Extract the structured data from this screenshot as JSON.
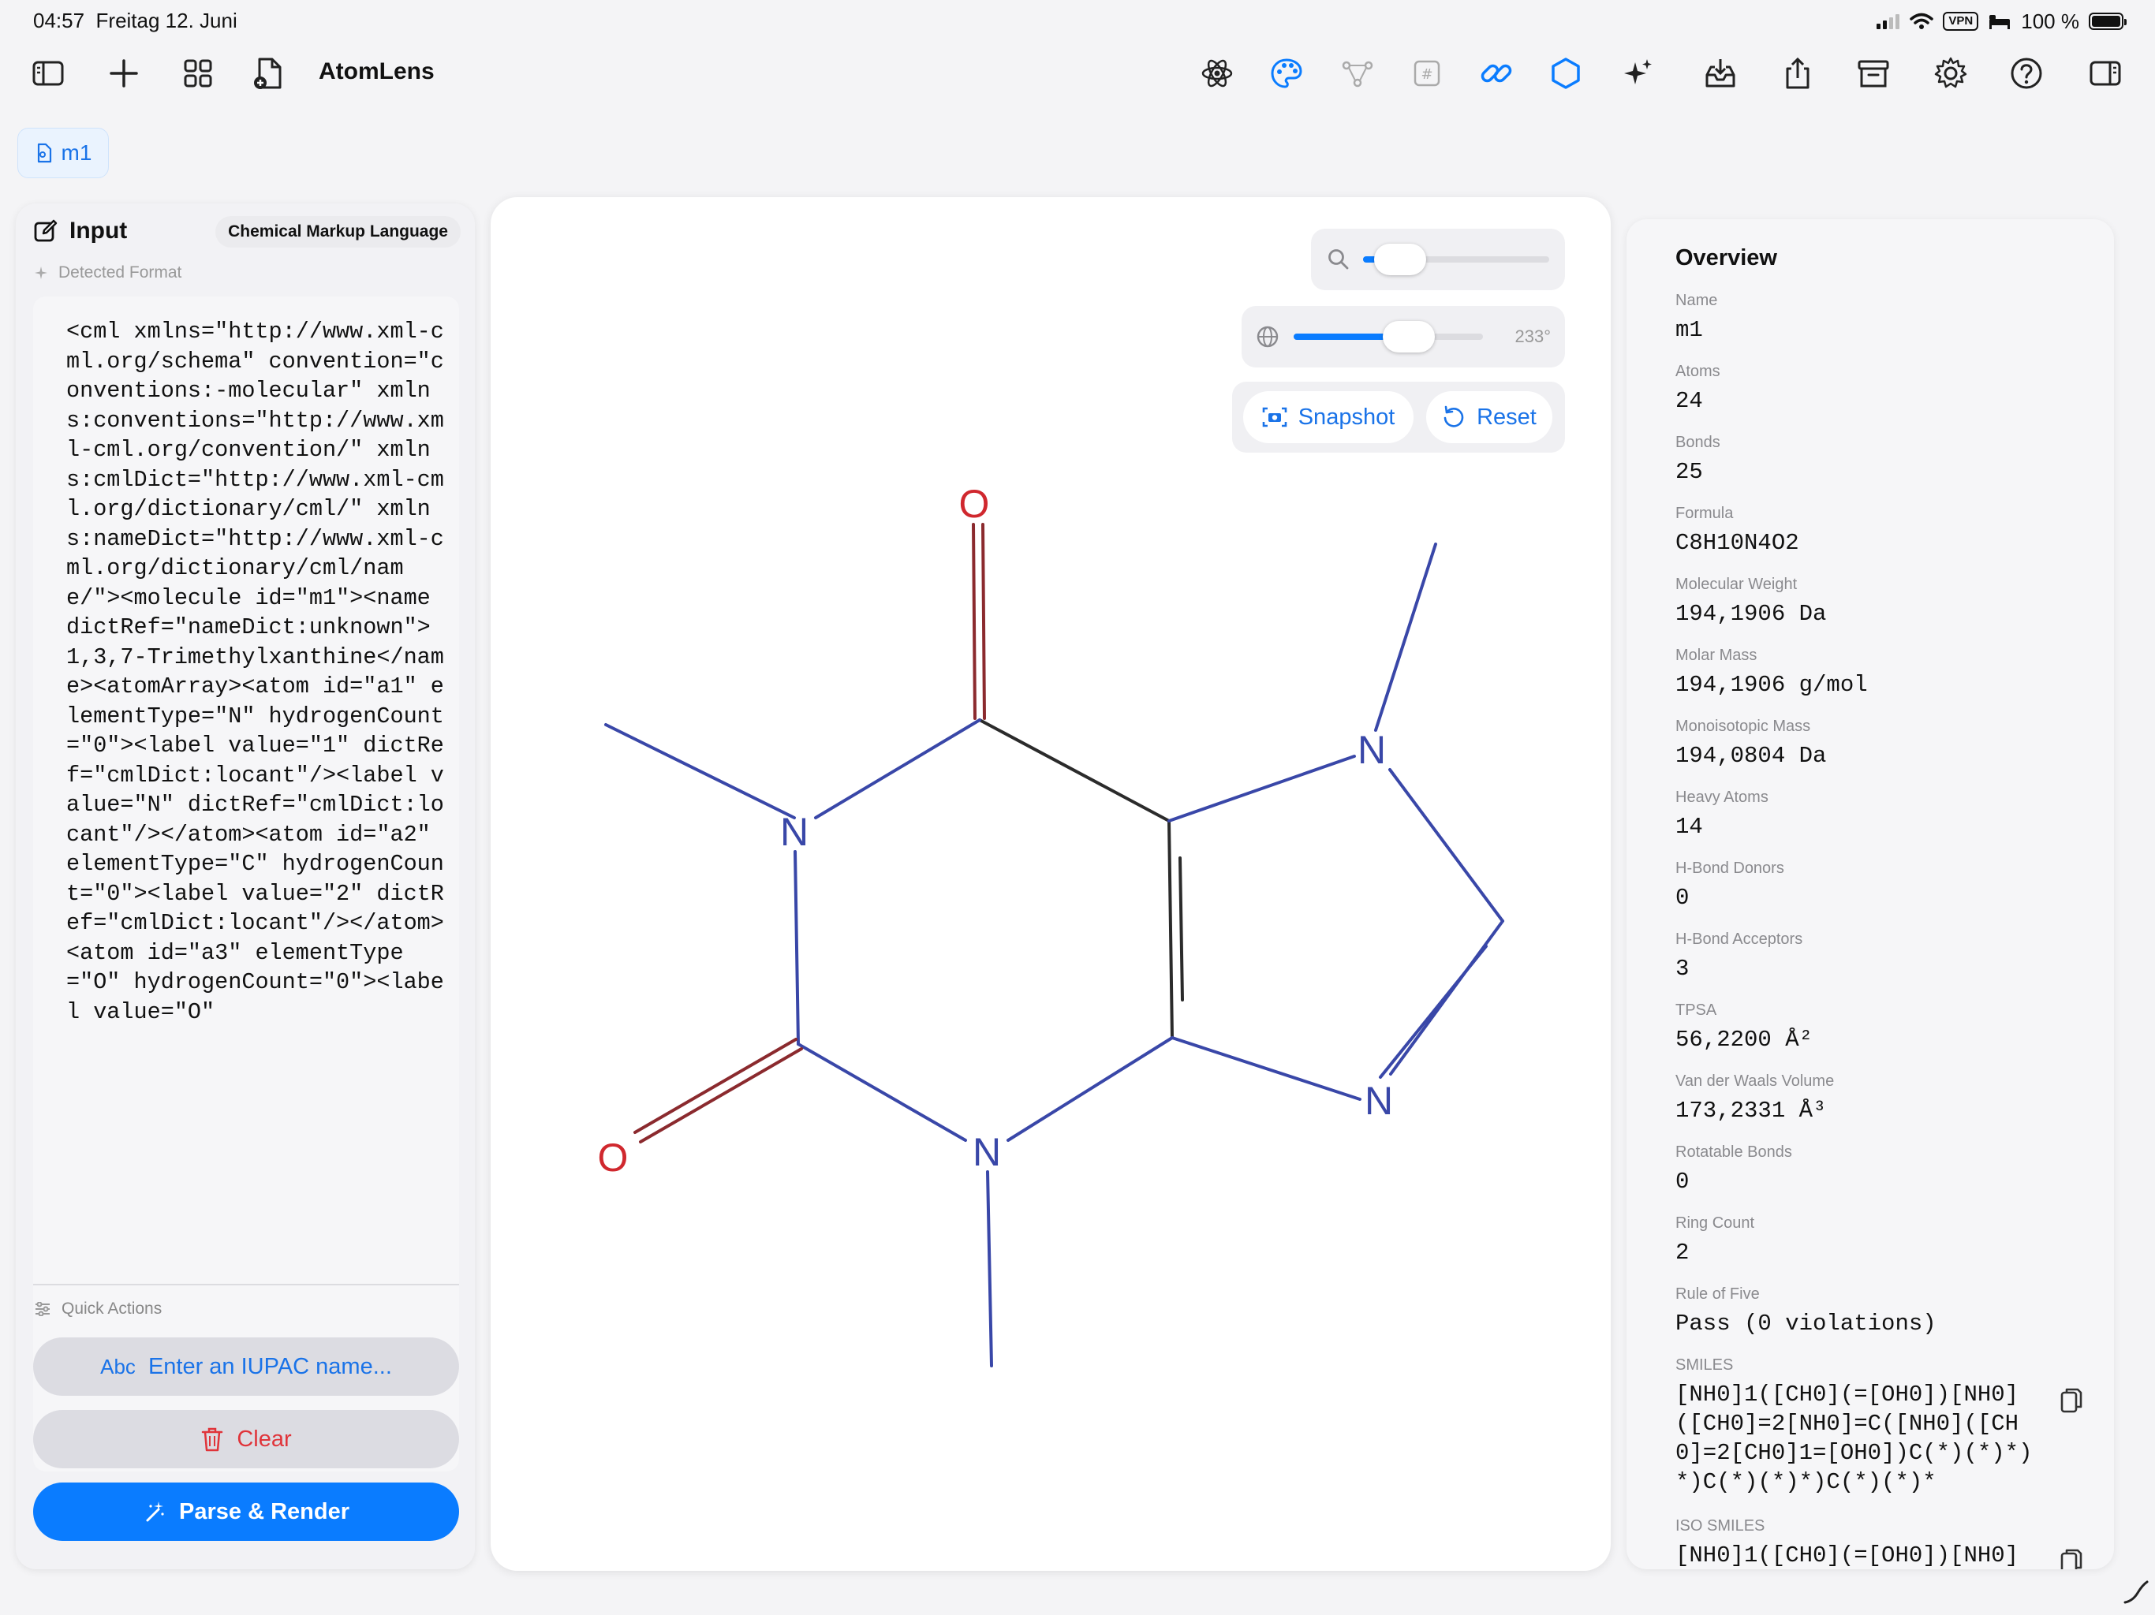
{
  "status": {
    "time": "04:57",
    "date": "Freitag 12. Juni",
    "vpn": "VPN",
    "battery": "100 %"
  },
  "app": {
    "title": "AtomLens"
  },
  "tab": {
    "label": "m1"
  },
  "input": {
    "title": "Input",
    "format": "Chemical Markup Language",
    "detected_label": "Detected Format",
    "code": "<cml xmlns=\"http://www.xml-cml.org/schema\" convention=\"conventions:-molecular\" xmlns:conventions=\"http://www.xml-cml.org/convention/\" xmlns:cmlDict=\"http://www.xml-cml.org/dictionary/cml/\" xmlns:nameDict=\"http://www.xml-cml.org/dictionary/cml/name/\"><molecule id=\"m1\"><name dictRef=\"nameDict:unknown\">1,3,7-Trimethylxanthine</name><atomArray><atom id=\"a1\" elementType=\"N\" hydrogenCount=\"0\"><label value=\"1\" dictRef=\"cmlDict:locant\"/><label value=\"N\" dictRef=\"cmlDict:locant\"/></atom><atom id=\"a2\" elementType=\"C\" hydrogenCount=\"0\"><label value=\"2\" dictRef=\"cmlDict:locant\"/></atom><atom id=\"a3\" elementType=\"O\" hydrogenCount=\"0\"><label value=\"O\"",
    "quick_actions_label": "Quick Actions",
    "iupac_prefix": "Abc",
    "iupac_label": "Enter an IUPAC name...",
    "clear_label": "Clear",
    "parse_label": "Parse & Render"
  },
  "viewer": {
    "zoom_level": 0.2,
    "rotation_level": 0.61,
    "rotation_angle": "233°",
    "snapshot_label": "Snapshot",
    "reset_label": "Reset",
    "atom_labels": {
      "o_top": "O",
      "o_left": "O",
      "n1": "N",
      "n3": "N",
      "n7": "N",
      "n9": "N"
    },
    "colors": {
      "carbon": "#2b2b2b",
      "nitrogen": "#3947a8",
      "oxygen": "#d0282e",
      "oxygen_bond": "#8b2a2e"
    }
  },
  "overview": {
    "title": "Overview",
    "props": [
      {
        "label": "Name",
        "value": "m1"
      },
      {
        "label": "Atoms",
        "value": "24"
      },
      {
        "label": "Bonds",
        "value": "25"
      },
      {
        "label": "Formula",
        "value": "C8H10N4O2"
      },
      {
        "label": "Molecular Weight",
        "value": "194,1906 Da"
      },
      {
        "label": "Molar Mass",
        "value": "194,1906 g/mol"
      },
      {
        "label": "Monoisotopic Mass",
        "value": "194,0804 Da"
      },
      {
        "label": "Heavy Atoms",
        "value": "14"
      },
      {
        "label": "H-Bond Donors",
        "value": "0"
      },
      {
        "label": "H-Bond Acceptors",
        "value": "3"
      },
      {
        "label": "TPSA",
        "value": "56,2200 Å²"
      },
      {
        "label": "Van der Waals Volume",
        "value": "173,2331 Å³"
      },
      {
        "label": "Rotatable Bonds",
        "value": "0"
      },
      {
        "label": "Ring Count",
        "value": "2"
      },
      {
        "label": "Rule of Five",
        "value": "Pass (0 violations)"
      }
    ],
    "smiles_label": "SMILES",
    "smiles": "[NH0]1([CH0](=[OH0])[NH0]([CH0]=2[NH0]=C([NH0]([CH0]=2[CH0]1=[OH0])C(*)(*)*)*)C(*)(*)*)C(*)(*)*",
    "iso_smiles_label": "ISO SMILES",
    "iso_smiles": "[NH0]1([CH0](=[OH0])[NH0]"
  },
  "accent": "#0a7cff"
}
